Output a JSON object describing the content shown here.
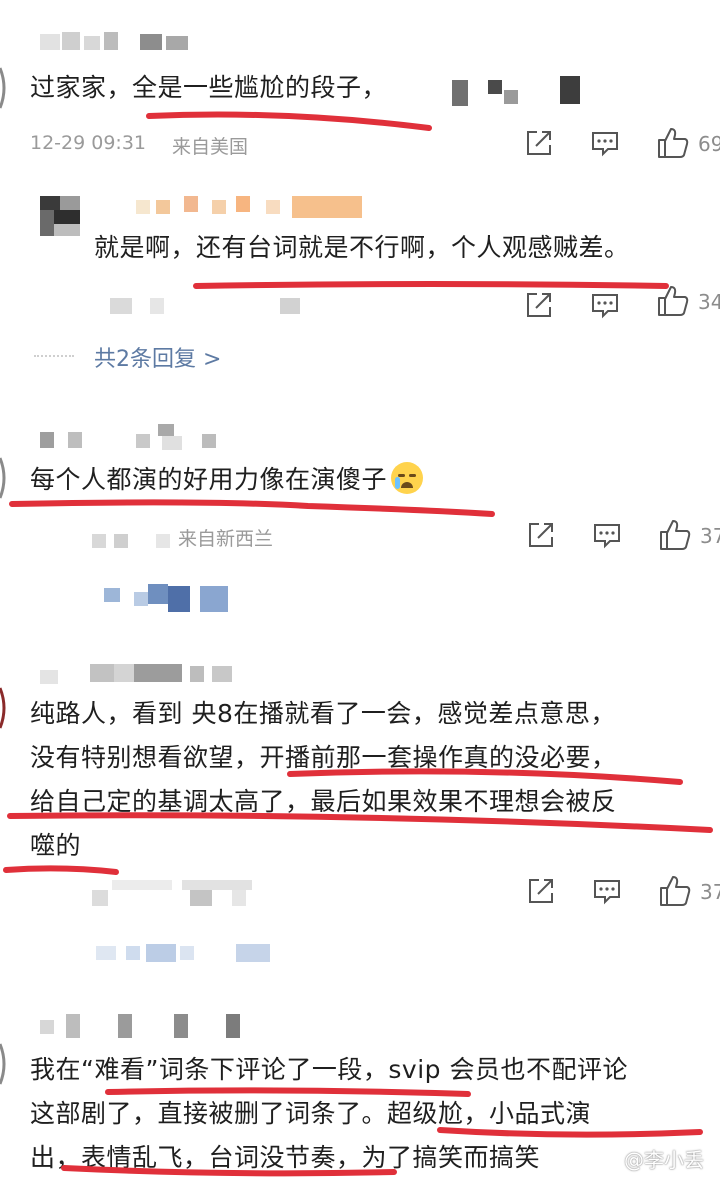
{
  "comments": [
    {
      "text": "过家家，全是一些尴尬的段子，",
      "time": "12-29 09:31",
      "location": "来自美国",
      "likes": "69",
      "replies": [
        {
          "text": "就是啊，还有台词就是不行啊，个人观感贼差。",
          "likes": "34"
        }
      ],
      "reply_summary": "共2条回复 >"
    },
    {
      "text": "每个人都演的好用力像在演傻子",
      "emoji": "crying-laughing",
      "location": "来自新西兰",
      "likes": "37"
    },
    {
      "lines": [
        "纯路人，看到 央8在播就看了一会，感觉差点意思，",
        "没有特别想看欲望，开播前那一套操作真的没必要，",
        "给自己定的基调太高了，最后如果效果不理想会被反",
        "噬的"
      ],
      "likes": "37"
    },
    {
      "lines": [
        "我在“难看”词条下评论了一段，svip 会员也不配评论",
        "这部剧了，直接被删了词条了。超级尬，小品式演",
        "出，表情乱飞，台词没节奏，为了搞笑而搞笑"
      ]
    }
  ],
  "watermark": "@李小丢",
  "colors": {
    "underline": "#e0303a",
    "meta": "#9a9a9a",
    "reply_link": "#5d7aa3"
  },
  "icons": [
    "share-icon",
    "comment-icon",
    "like-icon"
  ]
}
